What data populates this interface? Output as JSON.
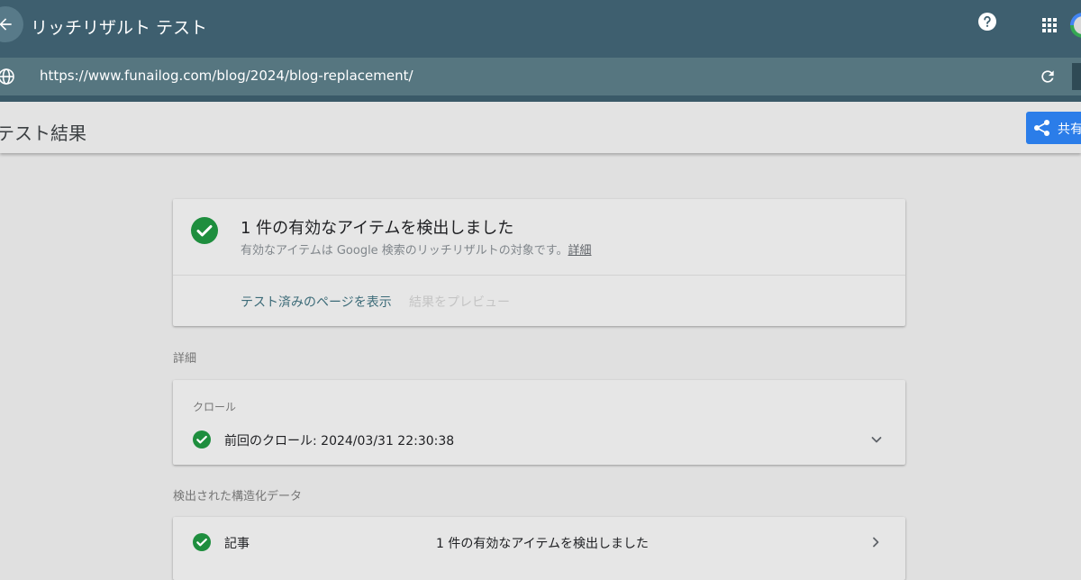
{
  "app": {
    "title": "リッチリザルト テスト",
    "url": "https://www.funailog.com/blog/2024/blog-replacement/",
    "icons": [
      "back-arrow-icon",
      "help-icon",
      "apps-grid-icon",
      "globe-icon",
      "reload-icon",
      "share-icon",
      "check-circle-icon",
      "chevron-down-icon",
      "chevron-right-icon"
    ]
  },
  "header": {
    "title": "テスト結果",
    "share_label": "共有"
  },
  "summary": {
    "title": "1 件の有効なアイテムを検出しました",
    "subtitle": "有効なアイテムは Google 検索のリッチリザルトの対象です。",
    "detail_link": "詳細",
    "view_page": "テスト済みのページを表示",
    "preview": "結果をプレビュー"
  },
  "details": {
    "section_label": "詳細",
    "crawl_label": "クロール",
    "last_crawl": "前回のクロール: 2024/03/31 22:30:38"
  },
  "structured_data": {
    "section_label": "検出された構造化データ",
    "items": [
      {
        "name": "記事",
        "status": "1 件の有効なアイテムを検出しました"
      }
    ]
  },
  "colors": {
    "appbar": "#3e5f6f",
    "urlbar": "#567680",
    "success": "#1e8e3e",
    "share": "#2b7de9"
  }
}
